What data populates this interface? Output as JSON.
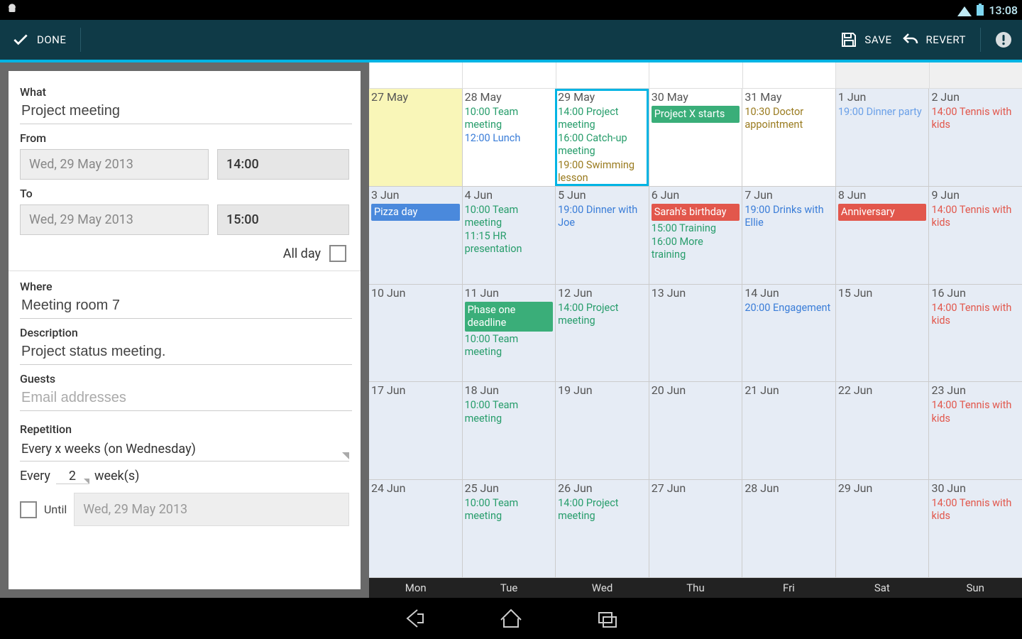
{
  "status": {
    "time": "13:08"
  },
  "actionbar": {
    "done": "DONE",
    "save": "SAVE",
    "revert": "REVERT"
  },
  "form": {
    "what_label": "What",
    "what_value": "Project meeting",
    "from_label": "From",
    "from_date": "Wed, 29 May 2013",
    "from_time": "14:00",
    "to_label": "To",
    "to_date": "Wed, 29 May 2013",
    "to_time": "15:00",
    "allday_label": "All day",
    "where_label": "Where",
    "where_value": "Meeting room 7",
    "desc_label": "Description",
    "desc_value": "Project status meeting.",
    "guests_label": "Guests",
    "guests_placeholder": "Email addresses",
    "rep_label": "Repetition",
    "rep_value": "Every x weeks (on Wednesday)",
    "every_prefix": "Every",
    "every_n": "2",
    "every_suffix": "week(s)",
    "until_label": "Until",
    "until_date": "Wed, 29 May 2013"
  },
  "dow": [
    "Mon",
    "Tue",
    "Wed",
    "Thu",
    "Fri",
    "Sat",
    "Sun"
  ],
  "weeks": [
    [
      {
        "date": "27 May",
        "today": true,
        "white": true,
        "events": []
      },
      {
        "date": "28 May",
        "white": true,
        "events": [
          {
            "t": "10:00 Team meeting",
            "c": "green"
          },
          {
            "t": "12:00 Lunch",
            "c": "blue"
          }
        ]
      },
      {
        "date": "29 May",
        "white": true,
        "sel": true,
        "events": [
          {
            "t": "14:00 Project meeting",
            "c": "green"
          },
          {
            "t": "16:00 Catch-up meeting",
            "c": "green"
          },
          {
            "t": "19:00 Swimming lesson",
            "c": "olive"
          }
        ]
      },
      {
        "date": "30 May",
        "white": true,
        "events": [
          {
            "badge": "green",
            "t": "Project X starts"
          }
        ]
      },
      {
        "date": "31 May",
        "white": true,
        "events": [
          {
            "t": "10:30 Doctor appointment",
            "c": "olive"
          }
        ]
      },
      {
        "date": "1 Jun",
        "events": [
          {
            "t": "19:00 Dinner party",
            "c": "ltblue"
          }
        ]
      },
      {
        "date": "2 Jun",
        "events": [
          {
            "t": "14:00 Tennis with kids",
            "c": "red"
          }
        ]
      }
    ],
    [
      {
        "date": "3 Jun",
        "events": [
          {
            "badge": "blue",
            "t": "Pizza day"
          }
        ]
      },
      {
        "date": "4 Jun",
        "events": [
          {
            "t": "10:00 Team meeting",
            "c": "green"
          },
          {
            "t": "11:15 HR presentation",
            "c": "green"
          }
        ]
      },
      {
        "date": "5 Jun",
        "events": [
          {
            "t": "19:00 Dinner with Joe",
            "c": "blue"
          }
        ]
      },
      {
        "date": "6 Jun",
        "events": [
          {
            "badge": "red",
            "t": "Sarah's birthday"
          },
          {
            "t": "15:00 Training",
            "c": "green"
          },
          {
            "t": "16:00 More training",
            "c": "green"
          }
        ]
      },
      {
        "date": "7 Jun",
        "events": [
          {
            "t": "19:00 Drinks with Ellie",
            "c": "blue"
          }
        ]
      },
      {
        "date": "8 Jun",
        "events": [
          {
            "badge": "red",
            "t": "Anniversary"
          }
        ]
      },
      {
        "date": "9 Jun",
        "events": [
          {
            "t": "14:00 Tennis with kids",
            "c": "red"
          }
        ]
      }
    ],
    [
      {
        "date": "10 Jun",
        "events": []
      },
      {
        "date": "11 Jun",
        "events": [
          {
            "badge": "green",
            "t": "Phase one deadline"
          },
          {
            "t": "10:00 Team meeting",
            "c": "green"
          }
        ]
      },
      {
        "date": "12 Jun",
        "events": [
          {
            "t": "14:00 Project meeting",
            "c": "green"
          }
        ]
      },
      {
        "date": "13 Jun",
        "events": []
      },
      {
        "date": "14 Jun",
        "events": [
          {
            "t": "20:00 Engagement",
            "c": "blue"
          }
        ]
      },
      {
        "date": "15 Jun",
        "events": []
      },
      {
        "date": "16 Jun",
        "events": [
          {
            "t": "14:00 Tennis with kids",
            "c": "red"
          }
        ]
      }
    ],
    [
      {
        "date": "17 Jun",
        "events": []
      },
      {
        "date": "18 Jun",
        "events": [
          {
            "t": "10:00 Team meeting",
            "c": "green"
          }
        ]
      },
      {
        "date": "19 Jun",
        "events": []
      },
      {
        "date": "20 Jun",
        "events": []
      },
      {
        "date": "21 Jun",
        "events": []
      },
      {
        "date": "22 Jun",
        "events": []
      },
      {
        "date": "23 Jun",
        "events": [
          {
            "t": "14:00 Tennis with kids",
            "c": "red"
          }
        ]
      }
    ],
    [
      {
        "date": "24 Jun",
        "events": []
      },
      {
        "date": "25 Jun",
        "events": [
          {
            "t": "10:00 Team meeting",
            "c": "green"
          }
        ]
      },
      {
        "date": "26 Jun",
        "events": [
          {
            "t": "14:00 Project meeting",
            "c": "green"
          }
        ]
      },
      {
        "date": "27 Jun",
        "events": []
      },
      {
        "date": "28 Jun",
        "events": []
      },
      {
        "date": "29 Jun",
        "events": []
      },
      {
        "date": "30 Jun",
        "events": [
          {
            "t": "14:00 Tennis with kids",
            "c": "red"
          }
        ]
      }
    ]
  ]
}
